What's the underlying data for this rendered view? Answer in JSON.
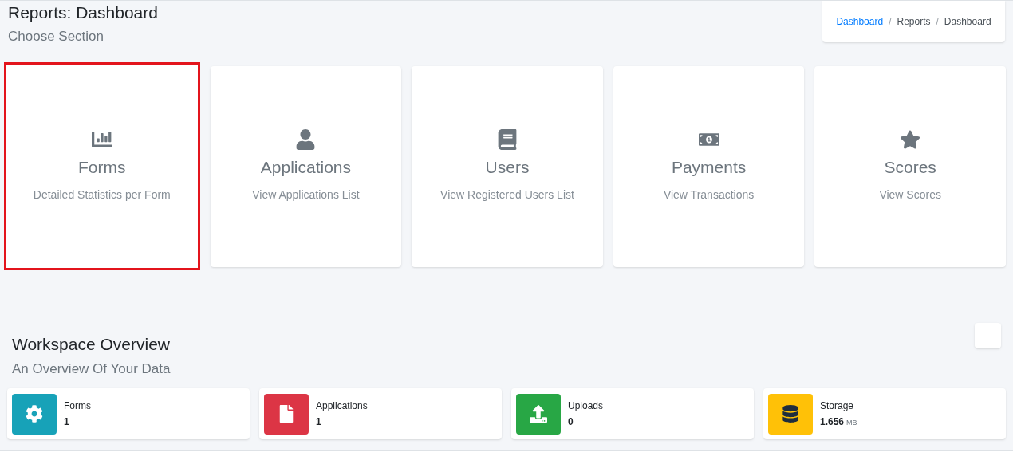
{
  "header": {
    "title": "Reports: Dashboard",
    "subtitle": "Choose Section"
  },
  "breadcrumb": [
    {
      "label": "Dashboard",
      "link": true
    },
    {
      "label": "/",
      "kind": "separator"
    },
    {
      "label": "Reports",
      "link": false
    },
    {
      "label": "/",
      "kind": "separator"
    },
    {
      "label": "Dashboard",
      "link": false
    }
  ],
  "sections": [
    {
      "kind": "chart",
      "title": "Forms",
      "description": "Detailed Statistics per Form",
      "selected": true
    },
    {
      "kind": "user",
      "title": "Applications",
      "description": "View Applications List",
      "selected": false
    },
    {
      "kind": "book",
      "title": "Users",
      "description": "View Registered Users List",
      "selected": false
    },
    {
      "kind": "money",
      "title": "Payments",
      "description": "View Transactions",
      "selected": false
    },
    {
      "kind": "star",
      "title": "Scores",
      "description": "View Scores",
      "selected": false
    }
  ],
  "overview": {
    "title": "Workspace Overview",
    "subtitle": "An Overview Of Your Data",
    "boxes": [
      {
        "kind": "gear",
        "label": "Forms",
        "value": "1",
        "color": "#17a2b8"
      },
      {
        "kind": "file",
        "label": "Applications",
        "value": "1",
        "color": "#dc3545"
      },
      {
        "kind": "upload",
        "label": "Uploads",
        "value": "0",
        "color": "#28a745"
      },
      {
        "kind": "database",
        "label": "Storage",
        "value": "1.656",
        "unit": "MB",
        "color": "#ffc107"
      }
    ]
  }
}
